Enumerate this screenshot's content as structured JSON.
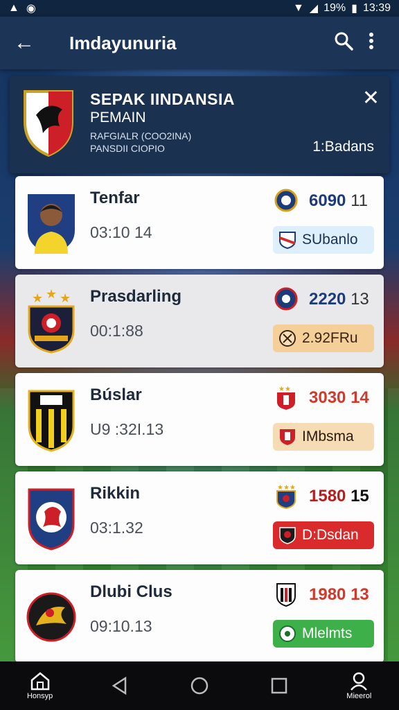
{
  "status": {
    "percent": "19%",
    "time": "13:39"
  },
  "appbar": {
    "title": "Imdayunuria"
  },
  "header": {
    "line1": "SEPAK IINDANSIA",
    "line2": "PEMAIN",
    "line3": "RAFGIALR (COO2INA)",
    "line4": "PANSDII CIOPIO",
    "count": "1:Badans"
  },
  "rows": [
    {
      "name": "Tenfar",
      "time": "03:10 14",
      "score": "6090",
      "score2": "11",
      "score_color": "#1d3b7a",
      "badge": "SUbanlo",
      "badge_bg": "#dceffb",
      "badge_fg": "#1c3152"
    },
    {
      "name": "Prasdarling",
      "time": "00:1:88",
      "score": "2220",
      "score2": "13",
      "score_color": "#1d3b7a",
      "badge": "2.92FRu",
      "badge_bg": "#f4cf99",
      "badge_fg": "#3a2410"
    },
    {
      "name": "Búslar",
      "time": "U9 :32I.13",
      "score": "3030",
      "score2": "14",
      "score_color": "#d0392b",
      "badge": "IMbsma",
      "badge_bg": "#f6dcb4",
      "badge_fg": "#2a1a0a"
    },
    {
      "name": "Rikkin",
      "time": "03:1.32",
      "score": "1580",
      "score2": "15",
      "score_color": "#b81e1e",
      "badge": "D:Dsdan",
      "badge_bg": "#d92b2b",
      "badge_fg": "#ffffff"
    },
    {
      "name": "Dlubi Clus",
      "time": "09:10.13",
      "score": "1980",
      "score2": "13",
      "score_color": "#d0392b",
      "badge": "Mlelmts",
      "badge_bg": "#3db04a",
      "badge_fg": "#ffffff"
    }
  ],
  "nav": {
    "home": "Honsyp",
    "profile": "Mieerol"
  },
  "colors": {
    "appbar": "#1c3556",
    "header": "#1a3150",
    "navbar": "#0b0b0d"
  }
}
